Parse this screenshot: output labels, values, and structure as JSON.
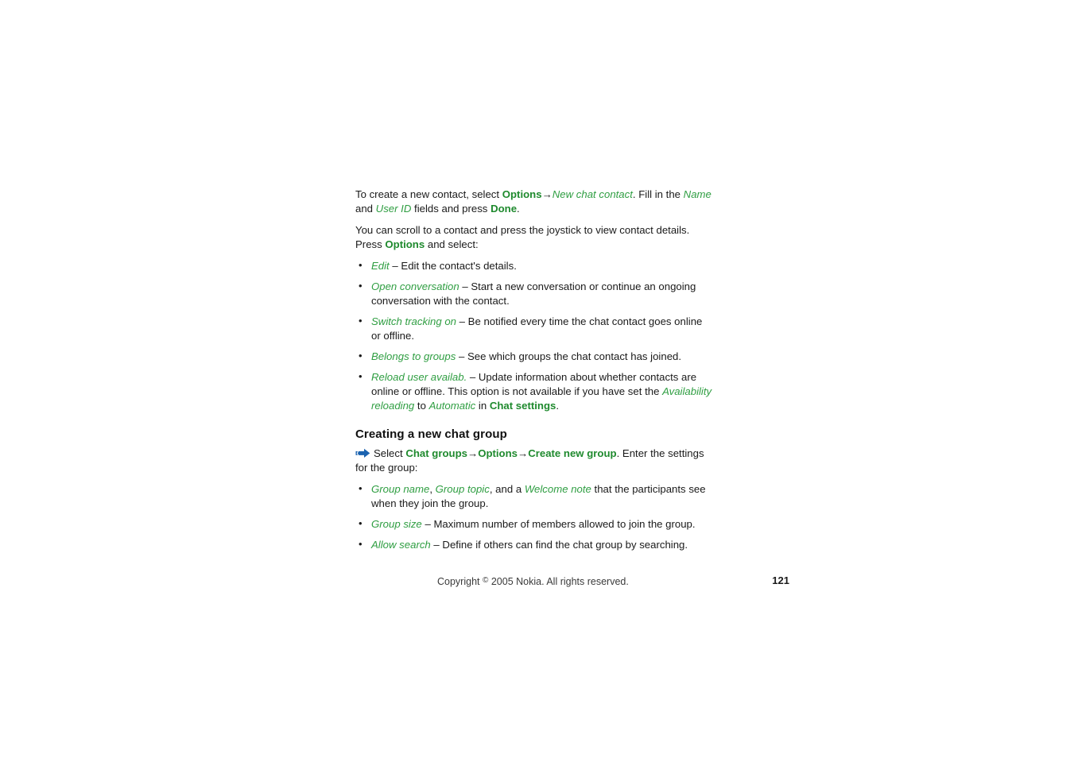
{
  "document": {
    "page_number": "121",
    "colors": {
      "green_bold": "#1f8a2e",
      "green_italic": "#2f9e42",
      "body_text": "#1a1a1a",
      "arrow_blue": "#1b63b0"
    }
  },
  "body": {
    "paragraph_1": {
      "t1": "To create a new contact, select ",
      "ui_options": "Options",
      "arrow_1": "→",
      "ui_new_chat_contact": "New chat contact",
      "t2": ". Fill in the ",
      "ui_name": "Name",
      "t3": " and ",
      "ui_user_id": "User ID",
      "t4": " fields and press ",
      "ui_done": "Done",
      "t5": "."
    },
    "paragraph_2": {
      "t1": "You can scroll to a contact and press the joystick to view contact details. Press ",
      "ui_options": "Options",
      "t2": " and select:"
    },
    "options_list": [
      {
        "term": "Edit",
        "desc": " – Edit the contact's details."
      },
      {
        "term": "Open conversation",
        "desc": " – Start a new conversation or continue an ongoing conversation with the contact."
      },
      {
        "term": "Switch tracking on",
        "desc": " – Be notified every time the chat contact goes online or offline."
      },
      {
        "term": "Belongs to groups",
        "desc": " – See which groups the chat contact has joined."
      }
    ],
    "reload_item": {
      "term": "Reload user availab.",
      "t1": " – Update information about whether contacts are online or offline. This option is not available if you have set the ",
      "ui_availability_reloading": "Availability reloading",
      "t2": " to ",
      "ui_automatic": "Automatic",
      "t3": " in ",
      "ui_chat_settings": "Chat settings",
      "t4": "."
    },
    "section_heading": "Creating a new chat group",
    "arrow_paragraph": {
      "t1": "Select ",
      "ui_chat_groups": "Chat groups",
      "arrow_1": "→",
      "ui_options": "Options",
      "arrow_2": "→",
      "ui_create_new_group": "Create new group",
      "t2": ". Enter the settings for the group:"
    },
    "group_list_first": {
      "ui_group_name": "Group name",
      "sep1": ", ",
      "ui_group_topic": "Group topic",
      "sep2": ", and a ",
      "ui_welcome_note": "Welcome note",
      "desc": " that the participants see when they join the group."
    },
    "group_list": [
      {
        "term": "Group size",
        "desc": " – Maximum number of members allowed to join the group."
      },
      {
        "term": "Allow search",
        "desc": " – Define if others can find the chat group by searching."
      }
    ]
  },
  "footer": {
    "copyright_prefix": "Copyright ",
    "copyright_mark": "©",
    "copyright_suffix": " 2005 Nokia. All rights reserved.",
    "page_number": "121"
  }
}
